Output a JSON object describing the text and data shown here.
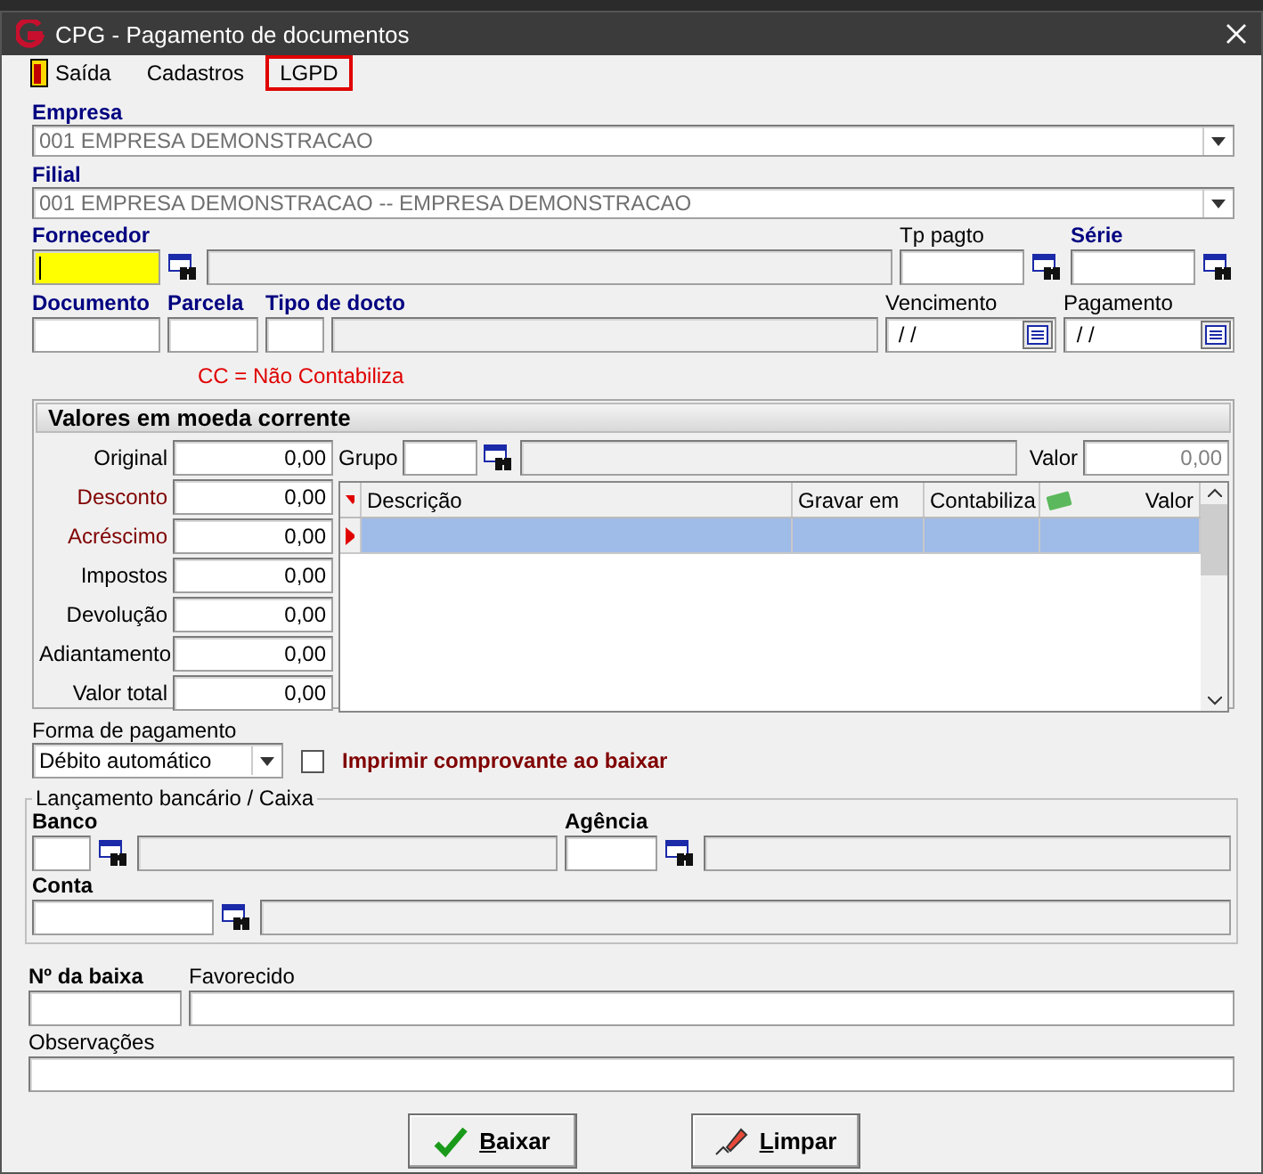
{
  "window": {
    "title": "CPG - Pagamento de documentos"
  },
  "menu": [
    {
      "label": "Saída",
      "kind": "exit",
      "highlighted": false
    },
    {
      "label": "Cadastros",
      "kind": "plain",
      "highlighted": false
    },
    {
      "label": "LGPD",
      "kind": "plain",
      "highlighted": true
    }
  ],
  "empresa": {
    "label": "Empresa",
    "value": "001 EMPRESA DEMONSTRACAO"
  },
  "filial": {
    "label": "Filial",
    "value": "001 EMPRESA DEMONSTRACAO -- EMPRESA DEMONSTRACAO"
  },
  "fornecedor": {
    "label": "Fornecedor",
    "required": true,
    "focused": true
  },
  "tp_pagto": {
    "label": "Tp pagto",
    "required": false
  },
  "serie": {
    "label": "Série",
    "required": true
  },
  "documento": {
    "label": "Documento",
    "required": true
  },
  "parcela": {
    "label": "Parcela",
    "required": true
  },
  "tipo_docto": {
    "label": "Tipo de docto",
    "required": true
  },
  "vencimento": {
    "label": "Vencimento",
    "required": false,
    "value": "/ /"
  },
  "pagamento": {
    "label": "Pagamento",
    "required": false,
    "value": "/ /"
  },
  "cc_note": "CC = Não Contabiliza",
  "valores": {
    "title": "Valores em moeda corrente",
    "rows": [
      {
        "label": "Original",
        "value": "0,00",
        "color": "#000000"
      },
      {
        "label": "Desconto",
        "value": "0,00",
        "color": "#800000"
      },
      {
        "label": "Acréscimo",
        "value": "0,00",
        "color": "#800000"
      },
      {
        "label": "Impostos",
        "value": "0,00",
        "color": "#000000"
      },
      {
        "label": "Devolução",
        "value": "0,00",
        "color": "#000000"
      },
      {
        "label": "Adiantamento",
        "value": "0,00",
        "color": "#000000"
      },
      {
        "label": "Valor total",
        "value": "0,00",
        "color": "#000000"
      }
    ],
    "grupo": {
      "label": "Grupo"
    },
    "valor": {
      "label": "Valor",
      "value": "0,00"
    },
    "table": {
      "columns": [
        "Descrição",
        "Gravar em",
        "Contabiliza",
        "Valor"
      ],
      "rows": [
        {
          "selected": true
        }
      ]
    }
  },
  "forma_pagamento": {
    "label": "Forma de pagamento",
    "value": "Débito automático"
  },
  "imprimir": {
    "label": "Imprimir comprovante ao baixar",
    "checked": false
  },
  "lancamento": {
    "title": "Lançamento bancário / Caixa",
    "banco": {
      "label": "Banco"
    },
    "agencia": {
      "label": "Agência"
    },
    "conta": {
      "label": "Conta"
    }
  },
  "n_baixa": {
    "label": "Nº da baixa"
  },
  "favorecido": {
    "label": "Favorecido"
  },
  "observacoes": {
    "label": "Observações"
  },
  "buttons": [
    {
      "label": "Baixar",
      "kind": "confirm"
    },
    {
      "label": "Limpar",
      "kind": "clear"
    }
  ]
}
